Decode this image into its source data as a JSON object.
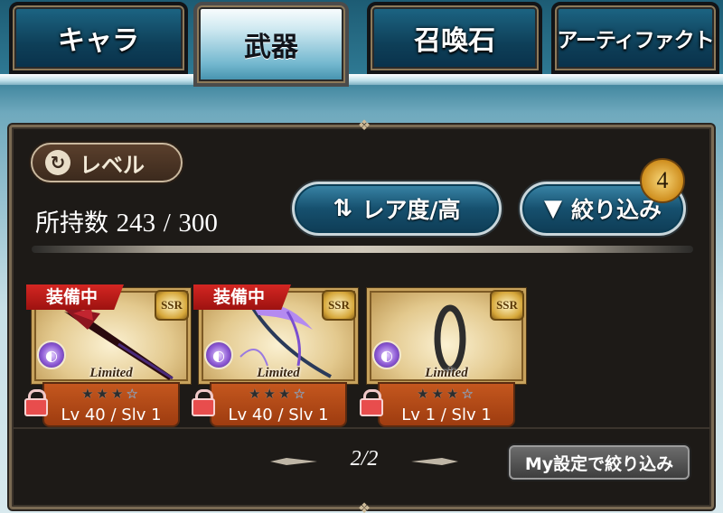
{
  "tabs": [
    {
      "label": "キャラ"
    },
    {
      "label": "武器"
    },
    {
      "label": "召喚石"
    },
    {
      "label": "アーティファクト"
    }
  ],
  "active_tab": "武器",
  "sort": {
    "level_label": "レベル",
    "rarity_label": "レア度/高"
  },
  "filter": {
    "label": "絞り込み",
    "badge_count": "4",
    "my_filter_label": "My設定で絞り込み"
  },
  "inventory": {
    "label": "所持数",
    "count": "243",
    "separator": "/",
    "max": "300"
  },
  "cards": [
    {
      "equipped_label": "装備中",
      "rarity": "SSR",
      "limited": "Limited",
      "stars_filled": 3,
      "stars_blue": 1,
      "level_text": "Lv 40 / Slv 1",
      "element_icon": "dark-element-icon"
    },
    {
      "equipped_label": "装備中",
      "rarity": "SSR",
      "limited": "Limited",
      "stars_filled": 3,
      "stars_blue": 1,
      "level_text": "Lv 40 / Slv 1",
      "element_icon": "dark-element-icon"
    },
    {
      "equipped_label": "",
      "rarity": "SSR",
      "limited": "Limited",
      "stars_filled": 3,
      "stars_blue": 1,
      "level_text": "Lv 1 / Slv 1",
      "element_icon": "dark-element-icon"
    }
  ],
  "pager": {
    "text": "2/2"
  },
  "colors": {
    "accent_blue": "#16506e",
    "equip_red": "#d42622",
    "info_orange": "#c4571e",
    "badge_gold": "#cf8e1e"
  }
}
